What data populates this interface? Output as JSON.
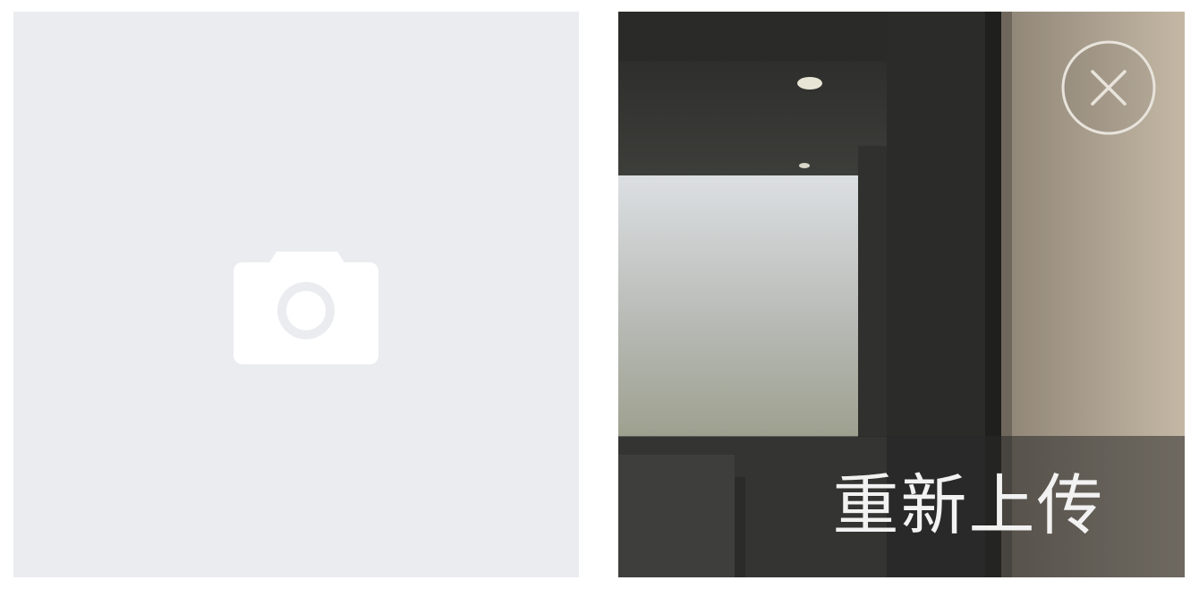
{
  "upload_slot": {
    "icon": "camera-icon",
    "background_color": "#ebecf0",
    "icon_color": "#ffffff"
  },
  "photo_slot": {
    "close_icon": "close-circle-icon",
    "reupload_label": "重新上传",
    "overlay_color": "rgba(40,40,40,0.55)"
  }
}
